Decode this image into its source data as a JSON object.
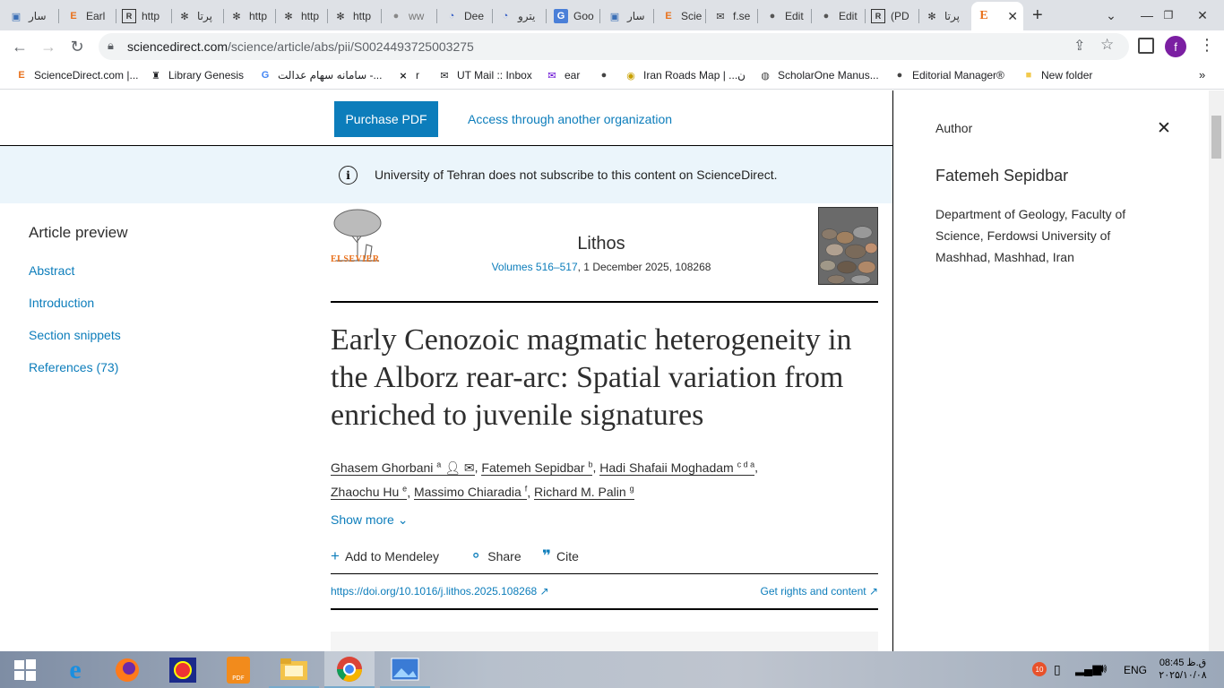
{
  "browser": {
    "tabs": [
      {
        "label": "سار",
        "icon": "bookmark-icon"
      },
      {
        "label": "Earl",
        "icon": "elsevier-icon"
      },
      {
        "label": "http",
        "icon": "researchgate-icon"
      },
      {
        "label": "پرتا",
        "icon": "gear-icon"
      },
      {
        "label": "http",
        "icon": "gear-icon"
      },
      {
        "label": "http",
        "icon": "gear-icon"
      },
      {
        "label": "http",
        "icon": "gear-icon"
      },
      {
        "label": "ww",
        "icon": "globe-icon"
      },
      {
        "label": "Dee",
        "icon": "deepl-icon"
      },
      {
        "label": "يترو",
        "icon": "deepl-icon"
      },
      {
        "label": "Goo",
        "icon": "google-icon"
      },
      {
        "label": "سار",
        "icon": "bookmark-icon"
      },
      {
        "label": "Scie",
        "icon": "elsevier-icon"
      },
      {
        "label": "f.se",
        "icon": "mail-icon"
      },
      {
        "label": "Edit",
        "icon": "globe-icon"
      },
      {
        "label": "Edit",
        "icon": "globe-icon"
      },
      {
        "label": "(PD",
        "icon": "researchgate-icon"
      },
      {
        "label": "پرتا",
        "icon": "gear-icon"
      }
    ],
    "url_host": "sciencedirect.com",
    "url_path": "/science/article/abs/pii/S0024493725003275",
    "profile_letter": "f",
    "bookmarks": [
      {
        "label": "ScienceDirect.com |...",
        "icon": "elsevier-icon"
      },
      {
        "label": "Library Genesis",
        "icon": "book-icon"
      },
      {
        "label": "سامانه سهام عدالت -...",
        "icon": "google-icon"
      },
      {
        "label": "r",
        "icon": "x-icon"
      },
      {
        "label": "UT Mail :: Inbox",
        "icon": "mail-icon"
      },
      {
        "label": "ear",
        "icon": "yahoo-mail-icon"
      },
      {
        "label": "",
        "icon": "globe-icon"
      },
      {
        "label": "Iran Roads Map | ...ن",
        "icon": "map-icon"
      },
      {
        "label": "ScholarOne Manus...",
        "icon": "scholarone-icon"
      },
      {
        "label": "Editorial Manager®",
        "icon": "globe-icon"
      },
      {
        "label": "New folder",
        "icon": "folder-icon"
      }
    ]
  },
  "page": {
    "purchase_label": "Purchase PDF",
    "access_label": "Access through another organization",
    "notice": "University of Tehran does not subscribe to this content on ScienceDirect.",
    "sidebar": {
      "title": "Article preview",
      "items": [
        "Abstract",
        "Introduction",
        "Section snippets",
        "References (73)"
      ]
    },
    "journal": {
      "publisher": "ELSEVIER",
      "name": "Lithos",
      "volume_link": "Volumes 516–517",
      "volume_rest": ", 1 December 2025, 108268"
    },
    "article": {
      "title": "Early Cenozoic magmatic heterogeneity in the Alborz rear-arc: Spatial variation from enriched to juvenile signatures",
      "authors": [
        {
          "name": "Ghasem Ghorbani",
          "sup": "a"
        },
        {
          "name": "Fatemeh Sepidbar",
          "sup": "b"
        },
        {
          "name": "Hadi Shafaii Moghadam",
          "sup": "c d a"
        },
        {
          "name": "Zhaochu Hu",
          "sup": "e"
        },
        {
          "name": "Massimo Chiaradia",
          "sup": "f"
        },
        {
          "name": "Richard M. Palin",
          "sup": "g"
        }
      ],
      "show_more": "Show more",
      "actions": {
        "mendeley": "Add to Mendeley",
        "share": "Share",
        "cite": "Cite"
      },
      "doi": "https://doi.org/10.1016/j.lithos.2025.108268",
      "rights": "Get rights and content"
    },
    "author_panel": {
      "label": "Author",
      "name": "Fatemeh Sepidbar",
      "affiliation": "Department of Geology, Faculty of Science, Ferdowsi University of Mashhad, Mashhad, Iran"
    }
  },
  "taskbar": {
    "language": "ENG",
    "time": "08:45 ق.ظ",
    "date": "۲۰۲۵/۱۰/۰۸",
    "notification_count": "10"
  },
  "colors": {
    "accent": "#0c7dbb",
    "notice_bg": "#ebf5fb",
    "elsevier_orange": "#e9711c"
  }
}
